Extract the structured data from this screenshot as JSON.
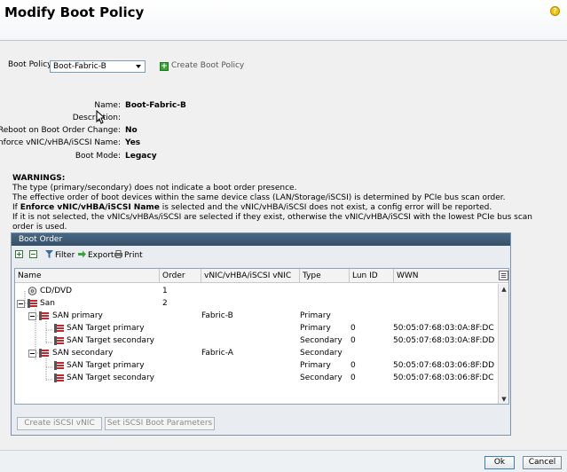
{
  "header": {
    "title": "Modify Boot Policy",
    "help_glyph": "?"
  },
  "policy": {
    "label": "Boot Policy:",
    "selected": "Boot-Fabric-B",
    "create_label": "Create Boot Policy"
  },
  "properties": [
    {
      "key": "Name:",
      "value": "Boot-Fabric-B"
    },
    {
      "key": "Description:",
      "value": ""
    },
    {
      "key": "Reboot on Boot Order Change:",
      "value": "No"
    },
    {
      "key": "Enforce vNIC/vHBA/iSCSI Name:",
      "value": "Yes"
    },
    {
      "key": "Boot Mode:",
      "value": "Legacy"
    }
  ],
  "warnings": {
    "heading": "WARNINGS:",
    "line1": "The type (primary/secondary) does not indicate a boot order presence.",
    "line2": "The effective order of boot devices within the same device class (LAN/Storage/iSCSI) is determined by PCIe bus scan order.",
    "line3_pre": "If ",
    "line3_bold": "Enforce vNIC/vHBA/iSCSI Name",
    "line3_post": " is selected and the vNIC/vHBA/iSCSI does not exist, a config error will be reported.",
    "line4": "If it is not selected, the vNICs/vHBAs/iSCSI are selected if they exist, otherwise the vNIC/vHBA/iSCSI with the lowest PCIe bus scan order is used."
  },
  "boot_order": {
    "title": "Boot Order",
    "toolbar": {
      "filter": "Filter",
      "export": "Export",
      "print": "Print"
    },
    "columns": [
      "Name",
      "Order",
      "vNIC/vHBA/iSCSI vNIC",
      "Type",
      "Lun ID",
      "WWN"
    ],
    "rows": [
      {
        "name": "CD/DVD",
        "order": "1",
        "vnic": "",
        "type": "",
        "lun": "",
        "wwn": ""
      },
      {
        "name": "San",
        "order": "2",
        "vnic": "",
        "type": "",
        "lun": "",
        "wwn": ""
      },
      {
        "name": "SAN primary",
        "order": "",
        "vnic": "Fabric-B",
        "type": "Primary",
        "lun": "",
        "wwn": ""
      },
      {
        "name": "SAN Target primary",
        "order": "",
        "vnic": "",
        "type": "Primary",
        "lun": "0",
        "wwn": "50:05:07:68:03:0A:8F:DC"
      },
      {
        "name": "SAN Target secondary",
        "order": "",
        "vnic": "",
        "type": "Secondary",
        "lun": "0",
        "wwn": "50:05:07:68:03:0A:8F:DD"
      },
      {
        "name": "SAN secondary",
        "order": "",
        "vnic": "Fabric-A",
        "type": "Secondary",
        "lun": "",
        "wwn": ""
      },
      {
        "name": "SAN Target primary",
        "order": "",
        "vnic": "",
        "type": "Primary",
        "lun": "0",
        "wwn": "50:05:07:68:03:06:8F:DD"
      },
      {
        "name": "SAN Target secondary",
        "order": "",
        "vnic": "",
        "type": "Secondary",
        "lun": "0",
        "wwn": "50:05:07:68:03:06:8F:DC"
      }
    ],
    "buttons": {
      "create_iscsi": "Create iSCSI vNIC",
      "set_iscsi": "Set iSCSI Boot Parameters"
    }
  },
  "footer": {
    "ok": "Ok",
    "cancel": "Cancel"
  },
  "colors": {
    "panel_header": "#35506a",
    "plus_green": "#3aa33a",
    "san_red": "#c0282d"
  }
}
